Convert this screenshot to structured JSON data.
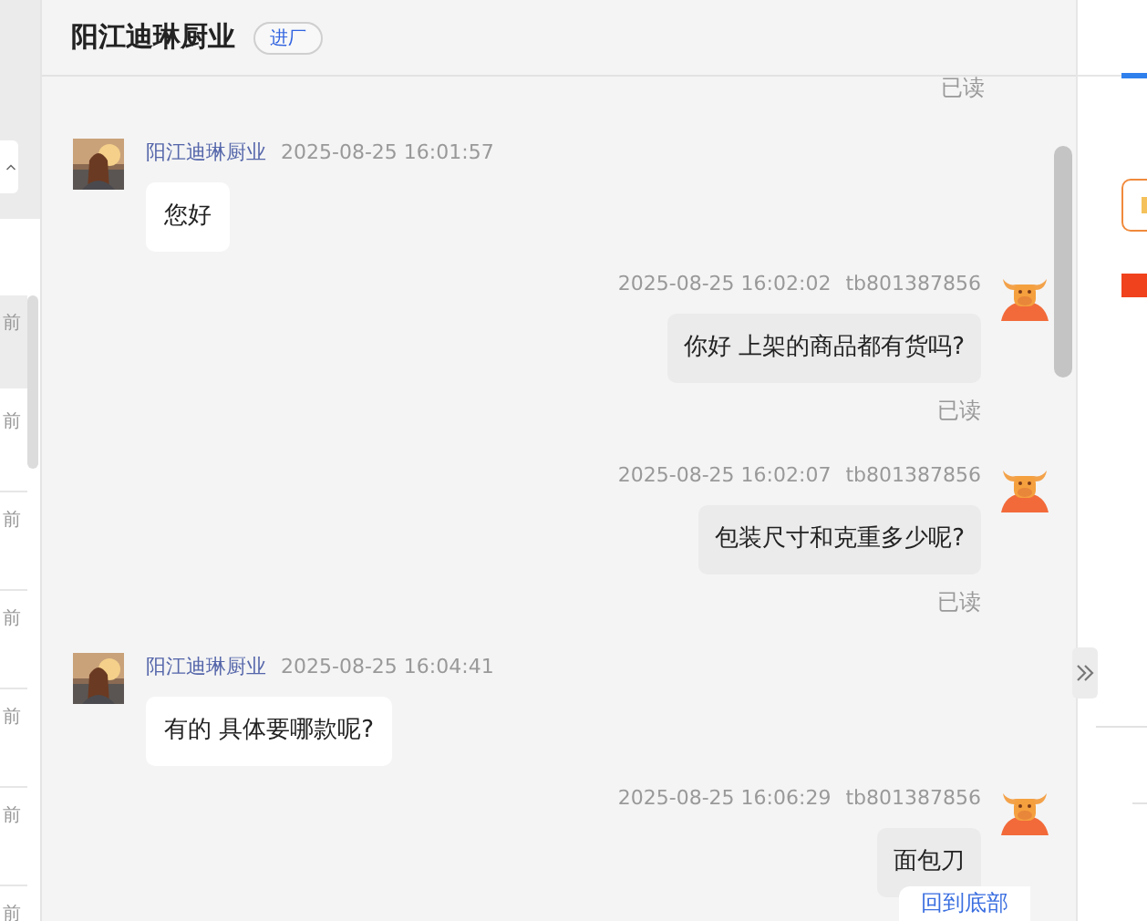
{
  "header": {
    "title": "阳江迪琳厨业",
    "badge": "进厂"
  },
  "sidebar": {
    "items": [
      {
        "time": "前",
        "selected": true
      },
      {
        "time": "前",
        "selected": false
      },
      {
        "time": "前",
        "selected": false
      },
      {
        "time": "前",
        "selected": false
      },
      {
        "time": "前",
        "selected": false
      },
      {
        "time": "前",
        "selected": false
      },
      {
        "time": "前",
        "selected": false
      }
    ]
  },
  "chat": {
    "top_receipt": "已读",
    "messages": [
      {
        "kind": "incoming",
        "sender": "阳江迪琳厨业",
        "time": "2025-08-25 16:01:57",
        "text": "您好"
      },
      {
        "kind": "outgoing",
        "sender": "tb801387856",
        "time": "2025-08-25 16:02:02",
        "text": "你好 上架的商品都有货吗?",
        "receipt": "已读"
      },
      {
        "kind": "outgoing",
        "sender": "tb801387856",
        "time": "2025-08-25 16:02:07",
        "text": "包装尺寸和克重多少呢?",
        "receipt": "已读"
      },
      {
        "kind": "incoming",
        "sender": "阳江迪琳厨业",
        "time": "2025-08-25 16:04:41",
        "text": "有的 具体要哪款呢?"
      },
      {
        "kind": "outgoing",
        "sender": "tb801387856",
        "time": "2025-08-25 16:06:29",
        "text": "面包刀"
      }
    ],
    "back_to_bottom": "回到底部"
  }
}
